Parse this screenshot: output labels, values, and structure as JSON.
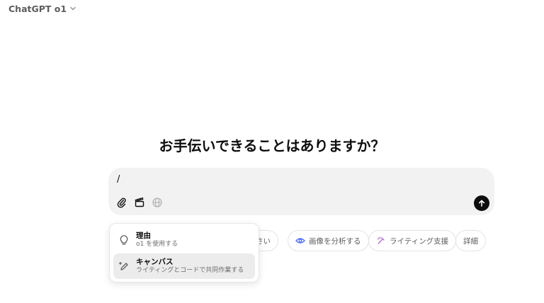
{
  "header": {
    "model_name": "ChatGPT o1"
  },
  "main": {
    "headline": "お手伝いできることはありますか？"
  },
  "composer": {
    "input_value": "/"
  },
  "chips": [
    {
      "label": "さい"
    },
    {
      "label": "画像を分析する"
    },
    {
      "label": "ライティング支援"
    },
    {
      "label": "詳細"
    }
  ],
  "slash_menu": {
    "items": [
      {
        "title": "理由",
        "subtitle": "o1 を使用する"
      },
      {
        "title": "キャンバス",
        "subtitle": "ライティングとコードで共同作業する"
      }
    ]
  },
  "colors": {
    "send_button": "#0d0d0d",
    "composer_bg": "#f2f2f2",
    "analyze_icon": "#4f6bff",
    "writing_icon": "#b36bd6"
  }
}
